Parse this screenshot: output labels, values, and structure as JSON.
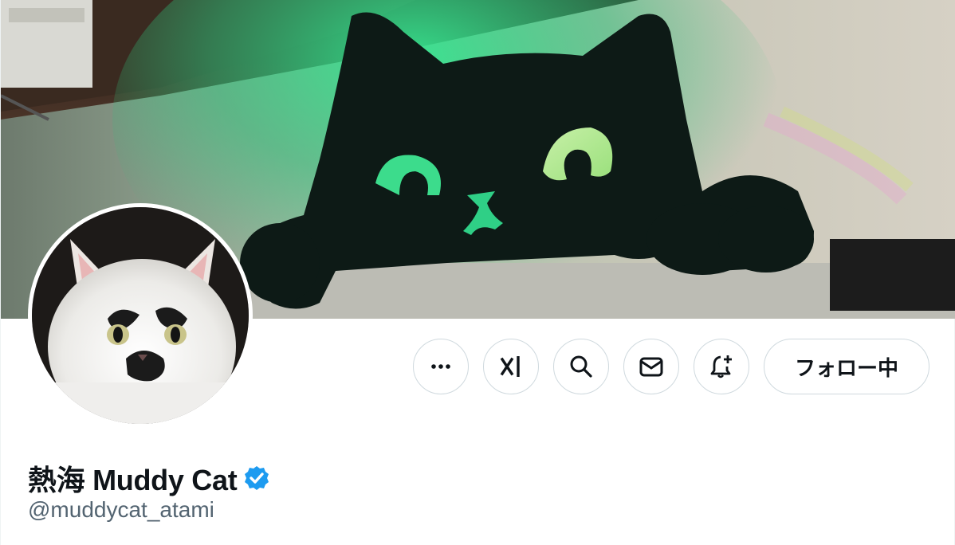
{
  "profile": {
    "display_name": "熱海 Muddy Cat",
    "handle": "@muddycat_atami",
    "verified": true,
    "verified_badge_color": "#1d9bf0"
  },
  "actions": {
    "more_icon": "more-horizontal-icon",
    "grok_icon": "grok-icon",
    "search_icon": "search-icon",
    "message_icon": "envelope-icon",
    "notify_icon": "bell-plus-icon",
    "follow_label": "フォロー中"
  },
  "theme": {
    "text_primary": "#0f1419",
    "text_secondary": "#536471",
    "border": "#cfd9de",
    "banner_glow": "#32e08a"
  }
}
